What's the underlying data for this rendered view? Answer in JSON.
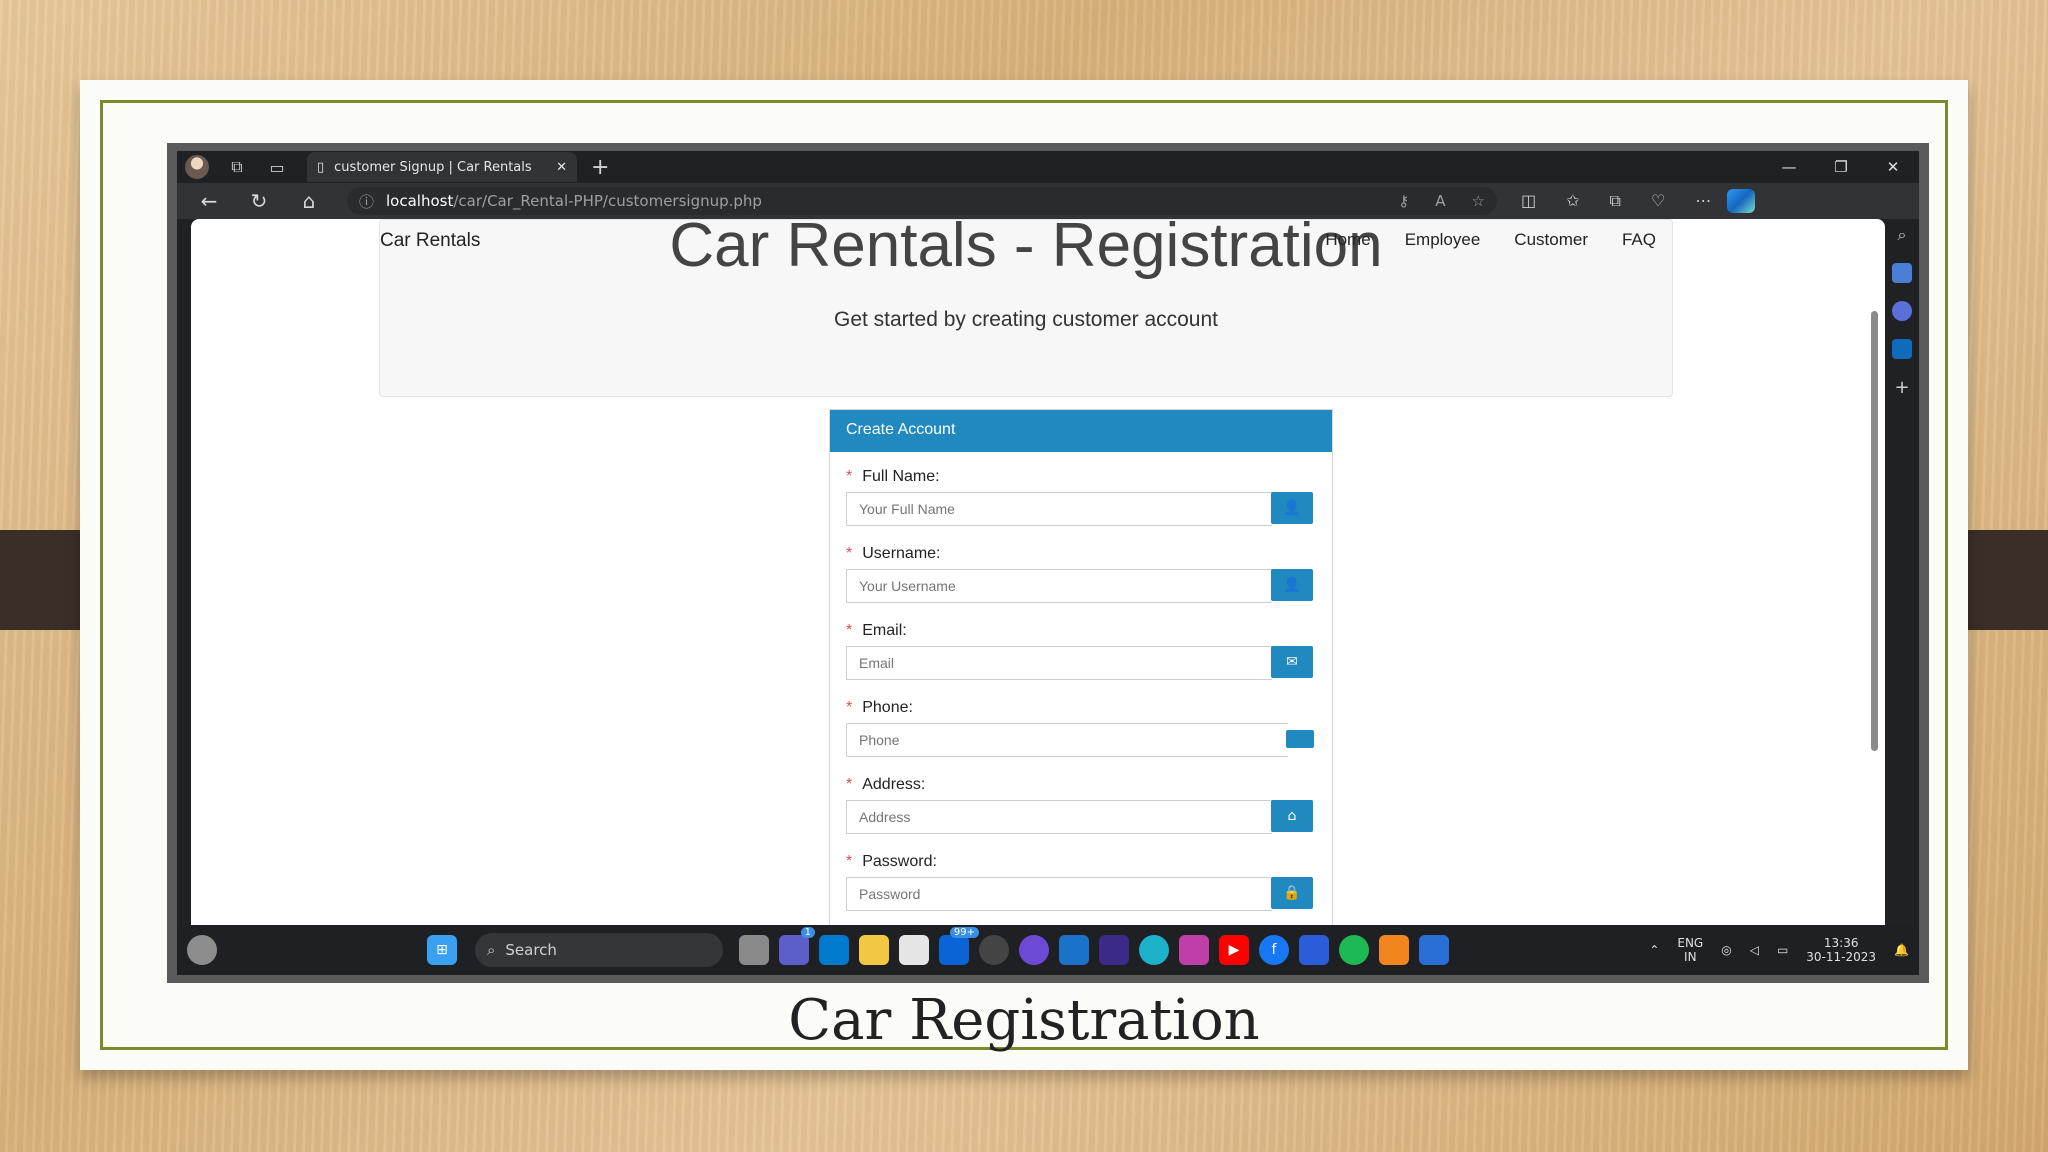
{
  "browser": {
    "tab_title": "customer Signup | Car Rentals",
    "url_host": "localhost",
    "url_path": "/car/Car_Rental-PHP/customersignup.php"
  },
  "site": {
    "brand": "Car Rentals",
    "nav": [
      "Home",
      "Employee",
      "Customer",
      "FAQ"
    ],
    "heading": "Car Rentals - Registration",
    "subheading": "Get started by creating customer account"
  },
  "form": {
    "panel_title": "Create Account",
    "fields": [
      {
        "label": "Full Name:",
        "placeholder": "Your Full Name",
        "icon": "user-icon"
      },
      {
        "label": "Username:",
        "placeholder": "Your Username",
        "icon": "user-icon"
      },
      {
        "label": "Email:",
        "placeholder": "Email",
        "icon": "envelope-icon"
      },
      {
        "label": "Phone:",
        "placeholder": "Phone",
        "icon": "phone-icon"
      },
      {
        "label": "Address:",
        "placeholder": "Address",
        "icon": "home-icon"
      },
      {
        "label": "Password:",
        "placeholder": "Password",
        "icon": "lock-icon"
      }
    ],
    "required_marker": "*"
  },
  "taskbar": {
    "search_label": "Search",
    "lang": "ENG",
    "region": "IN",
    "time": "13:36",
    "date": "30-11-2023",
    "badge_mail": "99+",
    "badge_teams": "1"
  },
  "slide": {
    "caption": "Car Registration"
  },
  "colors": {
    "accent": "#1f89c0",
    "frame_border": "#7a8a2a"
  }
}
